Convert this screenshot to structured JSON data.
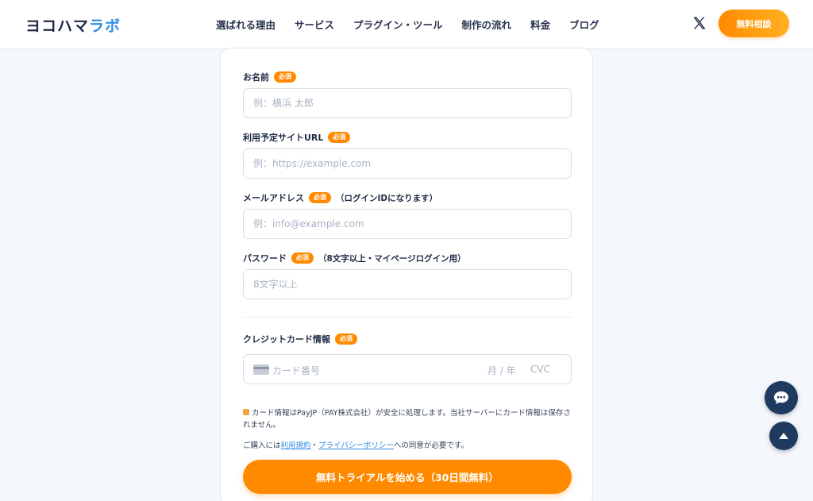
{
  "header": {
    "logo_main": "ヨコハマ",
    "logo_accent": "ラボ",
    "nav": [
      "選ばれる理由",
      "サービス",
      "プラグイン・ツール",
      "制作の流れ",
      "料金",
      "ブログ"
    ],
    "cta_label": "無料相談"
  },
  "form": {
    "required_label": "必須",
    "name": {
      "label": "お名前",
      "placeholder": "例：横浜 太郎"
    },
    "site_url": {
      "label": "利用予定サイトURL",
      "placeholder": "例：https://example.com"
    },
    "email": {
      "label": "メールアドレス",
      "note": "（ログインIDになります）",
      "placeholder": "例：info@example.com"
    },
    "password": {
      "label": "パスワード",
      "note": "（8文字以上・マイページログイン用）",
      "placeholder": "8文字以上"
    },
    "credit": {
      "label": "クレジットカード情報",
      "number_placeholder": "カード番号",
      "expiry_placeholder": "月 / 年",
      "cvc_placeholder": "CVC"
    },
    "security_note": "カード情報はPayJP（PAY株式会社）が安全に処理します。当社サーバーにカード情報は保存されません。",
    "agree_prefix": "ご購入には",
    "terms_link": "利用規約",
    "agree_sep": "・",
    "privacy_link": "プライバシーポリシー",
    "agree_suffix": "への同意が必要です。",
    "submit_label": "無料トライアルを始める（30日間無料）"
  },
  "colors": {
    "accent_orange": "#ff8a00",
    "brand_blue": "#2e8be6",
    "navy": "#1f3a5f"
  },
  "icons": [
    "x-logo-icon",
    "credit-card-icon",
    "lock-icon",
    "chat-icon",
    "arrow-up-icon"
  ]
}
